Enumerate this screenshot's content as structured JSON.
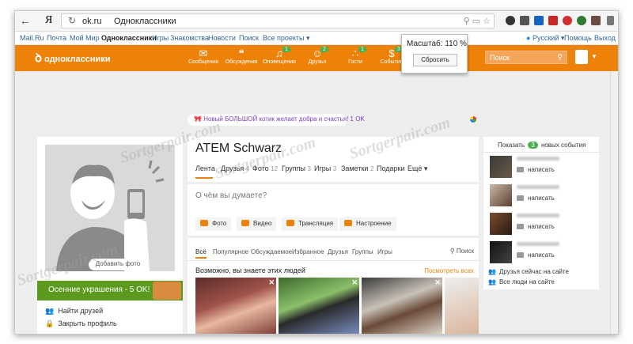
{
  "browser": {
    "back_label": "←",
    "yandex_logo": "Я",
    "url": "ok.ru",
    "page_title": "Одноклассники",
    "reload_icon": "reload-icon"
  },
  "oknav": {
    "items": [
      "Mail.Ru",
      "Почта",
      "Мой Мир",
      "Одноклассники",
      "Игры",
      "Знакомства",
      "Новости",
      "Поиск",
      "Все проекты ▾"
    ],
    "language": "Русский ▾",
    "help": "Помощь",
    "exit": "Выход"
  },
  "toolbar": {
    "logo": "одноклассники",
    "buttons": [
      {
        "label": "Сообщения",
        "icon": "✉",
        "badge": ""
      },
      {
        "label": "Обсуждения",
        "icon": "💬",
        "badge": ""
      },
      {
        "label": "Оповещения",
        "icon": "🔔",
        "badge": "1"
      },
      {
        "label": "Друзья",
        "icon": "👥",
        "badge": "2"
      },
      {
        "label": "Гости",
        "icon": "👣",
        "badge": "1"
      },
      {
        "label": "События",
        "icon": "$",
        "badge": "3"
      }
    ],
    "search_placeholder": "Поиск"
  },
  "zoom": {
    "label": "Масштаб: 110 %",
    "reset": "Сбросить"
  },
  "promo": "Новый БОЛЬШОЙ котик желает добра и счастья! 1 OK",
  "left": {
    "add_photo": "Добавить фото",
    "autumn_banner": "Осенние украшения - 5 OK!",
    "links": [
      "Найти друзей",
      "Закрыть профиль"
    ]
  },
  "profile": {
    "name": "ATEM Schwarz",
    "tabs": [
      {
        "label": "Лента",
        "count": ""
      },
      {
        "label": "Друзья",
        "count": "4"
      },
      {
        "label": "Фото",
        "count": "12"
      },
      {
        "label": "Группы",
        "count": "3"
      },
      {
        "label": "Игры",
        "count": "3"
      },
      {
        "label": "Заметки",
        "count": "2"
      },
      {
        "label": "Подарки",
        "count": ""
      },
      {
        "label": "Ещё ▾",
        "count": ""
      }
    ]
  },
  "post": {
    "placeholder": "О чём вы думаете?",
    "buttons": [
      "Фото",
      "Видео",
      "Трансляция",
      "Настроение"
    ]
  },
  "feed": {
    "tabs": [
      "Всё",
      "Популярное",
      "Обсуждаемое",
      "Избранное",
      "Друзья",
      "Группы",
      "Игры"
    ],
    "search": "Поиск",
    "maybe_know": "Возможно, вы знаете этих людей",
    "see_all": "Посмотреть всех"
  },
  "right": {
    "show": "Показать",
    "new_count": "3",
    "new_events": "новых события",
    "write_labels": [
      "написать",
      "написать",
      "написать",
      "написать"
    ],
    "friends_online": "Друзья сейчас на сайте",
    "all_online": "Все люди на сайте"
  },
  "watermark": "Sortgerpair.com",
  "colors": {
    "ok_orange": "#ee8208",
    "green_banner": "#5b9a1e",
    "badge_green": "#4caf50",
    "link_blue": "#336699"
  }
}
